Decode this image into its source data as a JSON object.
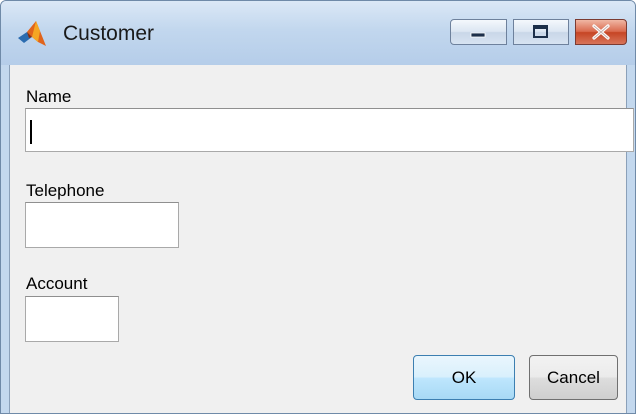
{
  "window": {
    "title": "Customer"
  },
  "form": {
    "name": {
      "label": "Name",
      "value": ""
    },
    "telephone": {
      "label": "Telephone",
      "value": ""
    },
    "account": {
      "label": "Account",
      "value": ""
    }
  },
  "buttons": {
    "ok_label": "OK",
    "cancel_label": "Cancel"
  },
  "icons": {
    "app": "matlab-logo-icon",
    "minimize": "minimize-icon",
    "maximize": "maximize-icon",
    "close": "close-icon"
  },
  "colors": {
    "titlebar": "#c2d7ee",
    "client_background": "#f0f0f0",
    "close_button": "#c64524",
    "ok_button_border": "#3c7fb1"
  }
}
